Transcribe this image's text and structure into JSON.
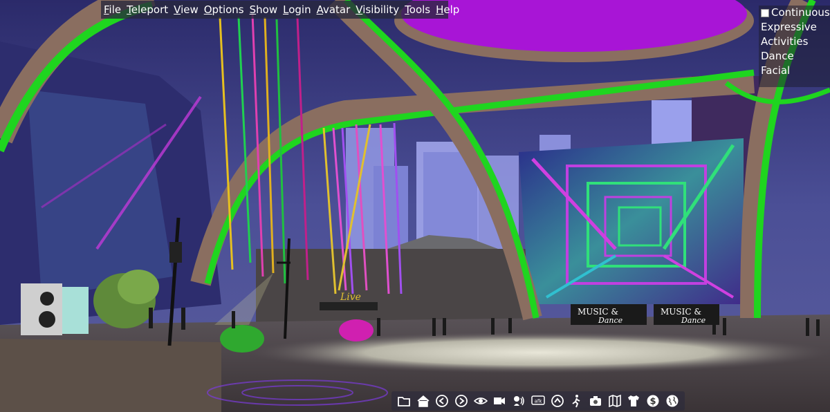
{
  "menubar": {
    "items": [
      {
        "label": "File",
        "underline": "F",
        "rest": "ile"
      },
      {
        "label": "Teleport",
        "underline": "T",
        "rest": "eleport"
      },
      {
        "label": "View",
        "underline": "V",
        "rest": "iew"
      },
      {
        "label": "Options",
        "underline": "O",
        "rest": "ptions"
      },
      {
        "label": "Show",
        "underline": "S",
        "rest": "how"
      },
      {
        "label": "Login",
        "underline": "L",
        "rest": "ogin"
      },
      {
        "label": "Avatar",
        "underline": "A",
        "rest": "vatar"
      },
      {
        "label": "Visibility",
        "underline": "V",
        "rest": "isibility"
      },
      {
        "label": "Tools",
        "underline": "T",
        "rest": "ools"
      },
      {
        "label": "Help",
        "underline": "H",
        "rest": "elp"
      }
    ]
  },
  "gestures": {
    "items": [
      "Continuous",
      "Expressive",
      "Activities",
      "Dance",
      "Facial"
    ]
  },
  "scene": {
    "sign_live": "Live",
    "sign_music_1": "MUSIC &",
    "sign_dance_1": "Dance",
    "sign_music_2": "MUSIC &",
    "sign_dance_2": "Dance"
  },
  "toolbar": {
    "buttons": [
      "folder-icon",
      "home-icon",
      "back-icon",
      "forward-icon",
      "eye-icon",
      "camera-icon",
      "speaker-icon",
      "afk-icon",
      "up-icon",
      "walk-icon",
      "snapshot-icon",
      "map-icon",
      "shirt-icon",
      "money-icon",
      "globe-icon"
    ],
    "afk_text": "afk"
  },
  "colors": {
    "arch_green": "#1fd51f",
    "purple": "#a815d6",
    "sky": "#3b3e8a",
    "ground": "#4a4346"
  }
}
